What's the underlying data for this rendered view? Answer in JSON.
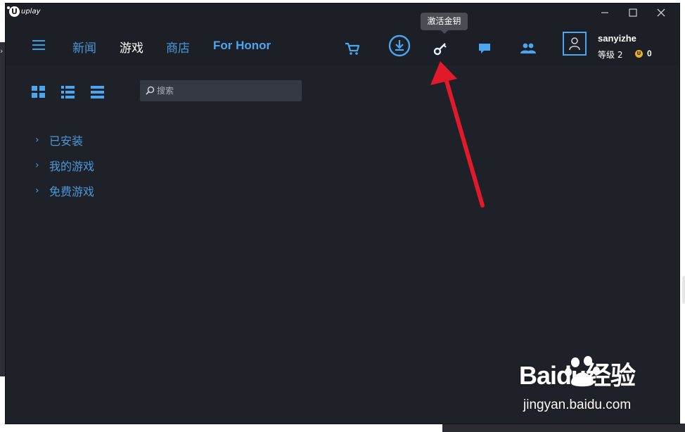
{
  "window": {
    "brand": "uplay"
  },
  "window_controls": [
    "minimize",
    "maximize",
    "close"
  ],
  "nav": {
    "items": [
      {
        "label": "新闻",
        "active": false
      },
      {
        "label": "游戏",
        "active": true
      },
      {
        "label": "商店",
        "active": false
      },
      {
        "label": "For Honor",
        "active": false
      }
    ],
    "icons": [
      "cart-icon",
      "download-icon",
      "key-icon",
      "chat-icon",
      "friends-icon"
    ],
    "tooltip": "激活金钥"
  },
  "user": {
    "name": "sanyizhe",
    "level_label": "等级",
    "level": "2",
    "coin_symbol": "U",
    "coins": "0"
  },
  "library": {
    "view_modes": [
      "grid-view",
      "list-view",
      "compact-list-view"
    ],
    "search": {
      "value": "",
      "placeholder": "搜索"
    },
    "categories": [
      {
        "label": "已安装"
      },
      {
        "label": "我的游戏"
      },
      {
        "label": "免费游戏"
      }
    ]
  },
  "watermark": {
    "brand": "Baidu经验",
    "url": "jingyan.baidu.com"
  },
  "colors": {
    "accent": "#4aa6f0",
    "background": "#1e2128",
    "bar": "#1c1f25",
    "arrow": "#e0192b",
    "coin": "#e8b223"
  }
}
